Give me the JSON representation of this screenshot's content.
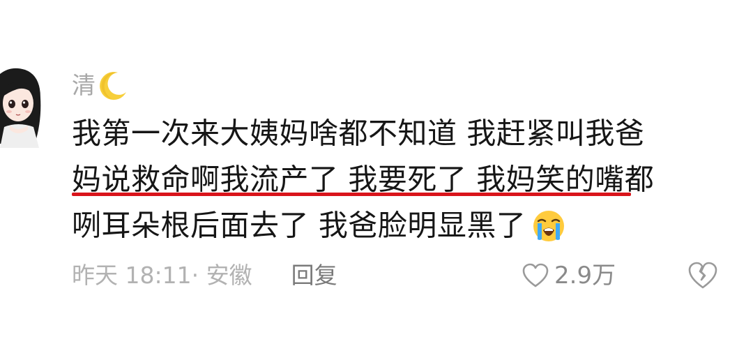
{
  "comment": {
    "username": "清",
    "username_emoji": "crescent-moon-icon",
    "lines": [
      "我第一次来大姨妈啥都不知道 我赶紧叫我爸",
      "妈说救命啊我流产了 我要死了 我妈笑的嘴都",
      "咧耳朵根后面去了 我爸脸明显黑了"
    ],
    "end_emoji": "loudly-crying-face-icon",
    "highlight_color": "#d9141b",
    "time_location": "昨天 18:11· 安徽",
    "reply_label": "回复",
    "like_count": "2.9万"
  }
}
